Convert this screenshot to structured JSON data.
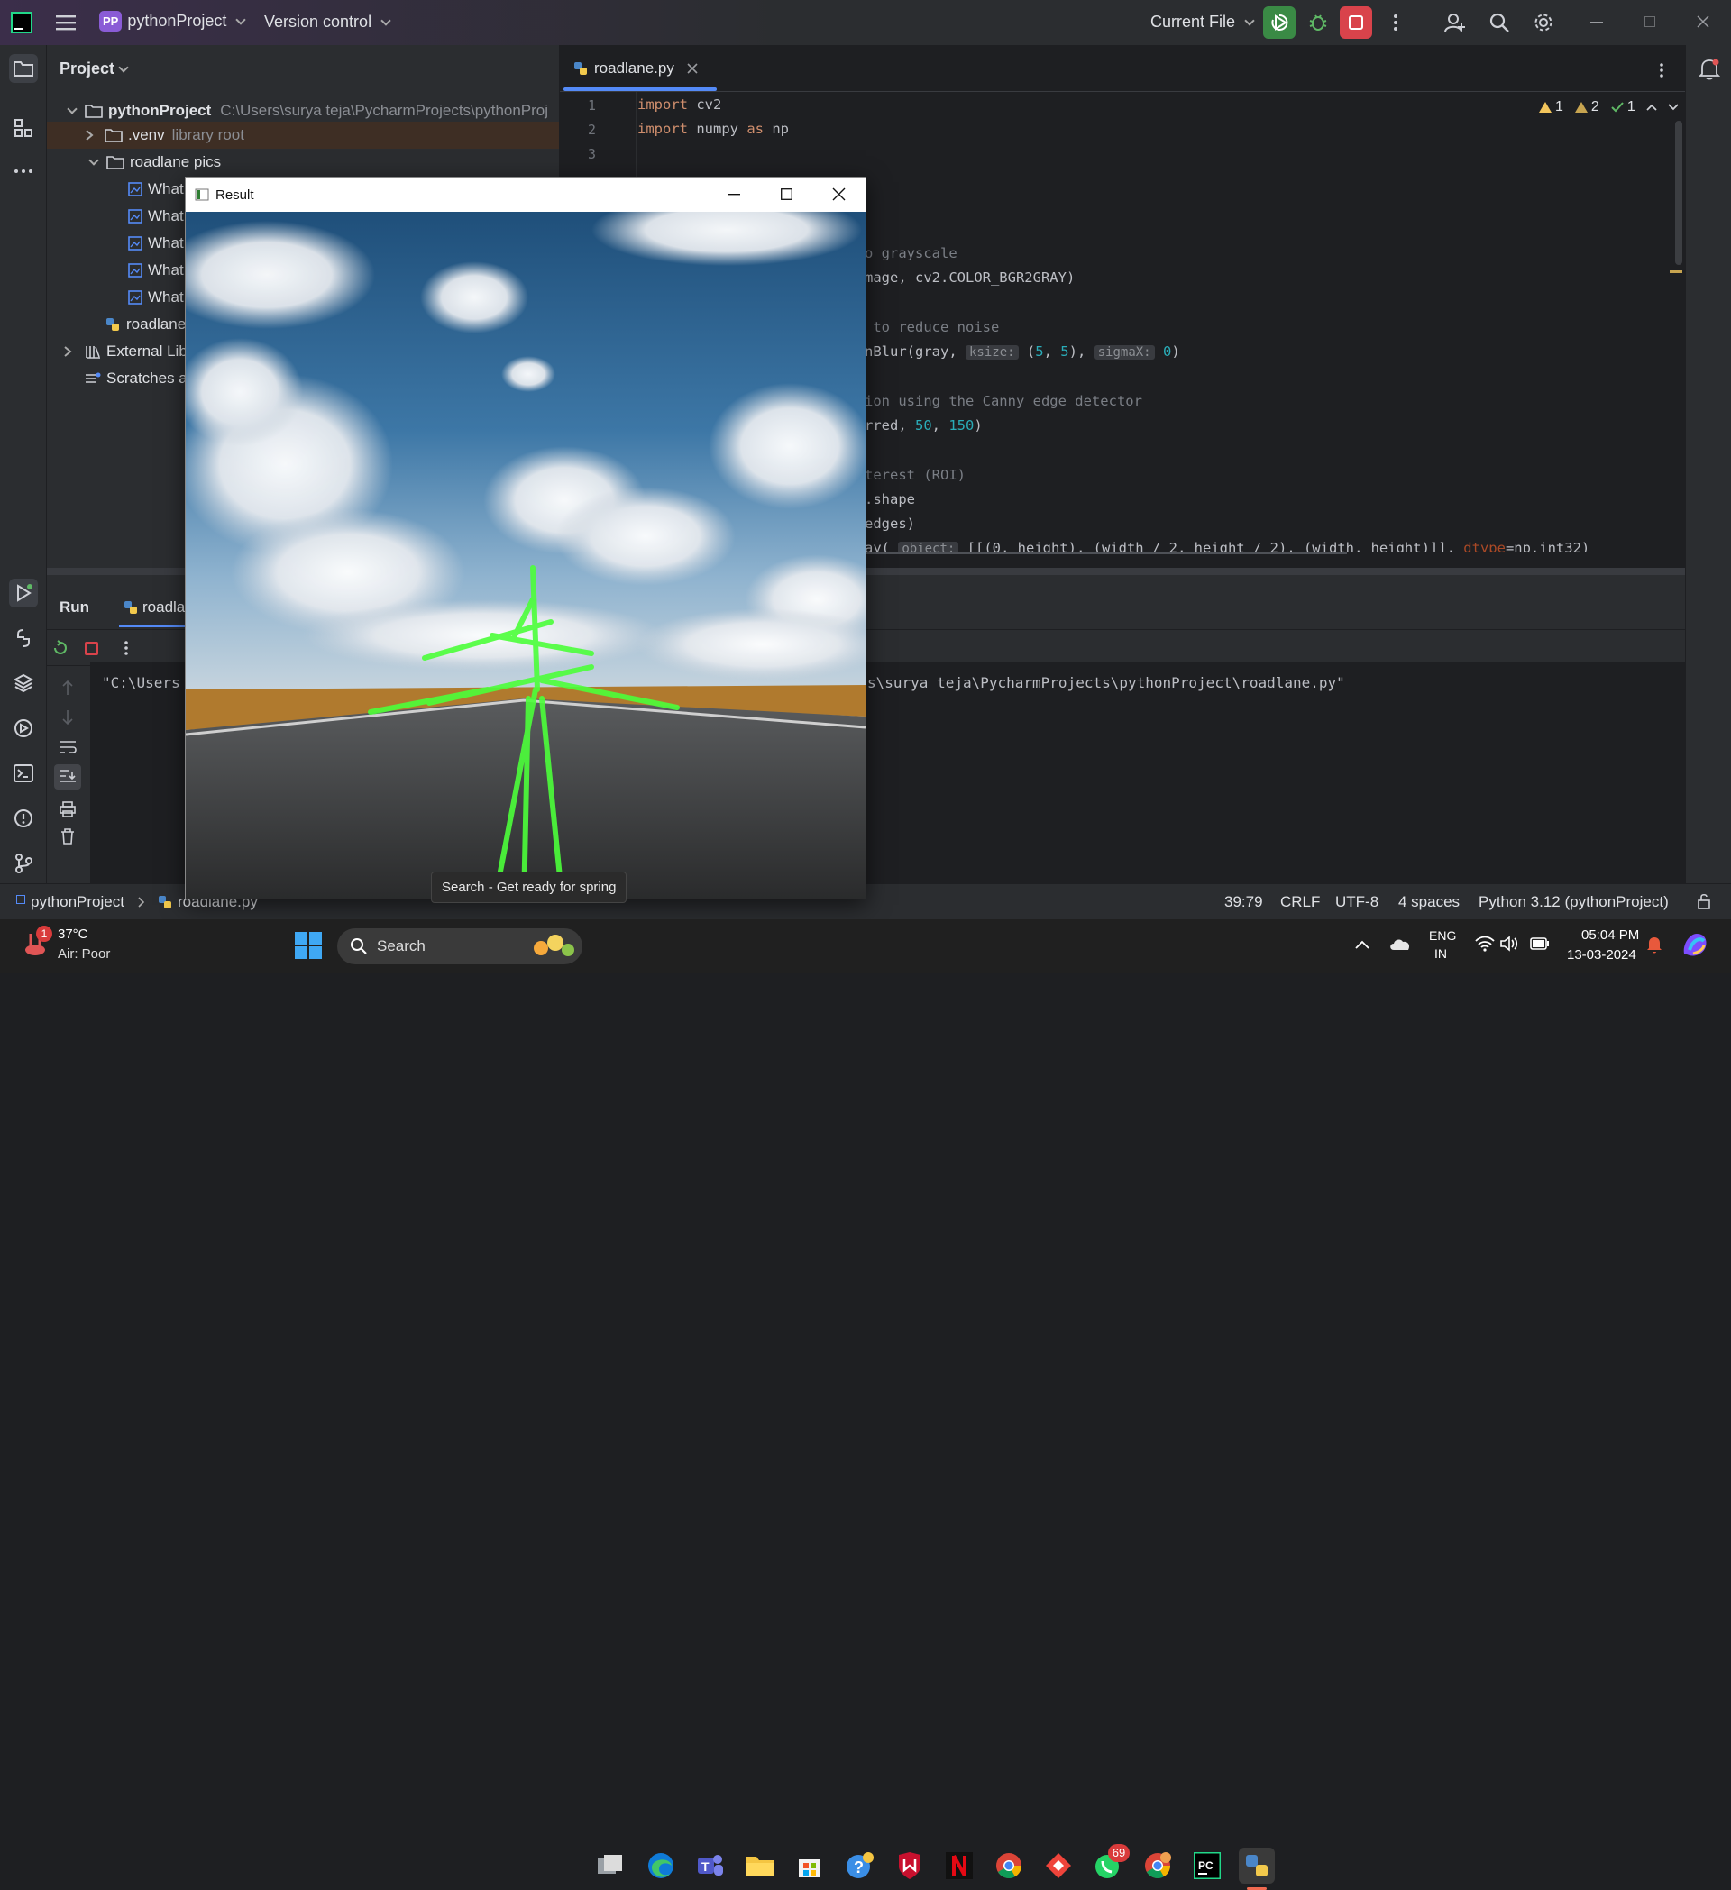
{
  "titlebar": {
    "project_badge": "PP",
    "project_name": "pythonProject",
    "version_control": "Version control",
    "run_config": "Current File"
  },
  "project_panel": {
    "title": "Project",
    "root_name": "pythonProject",
    "root_path": "C:\\Users\\surya teja\\PycharmProjects\\pythonProj",
    "venv": ".venv",
    "venv_note": "library root",
    "folder": "roadlane pics",
    "files": [
      "What",
      "What",
      "What",
      "What",
      "What"
    ],
    "script": "roadlane",
    "external": "External Lib",
    "scratches": "Scratches a"
  },
  "editor": {
    "tab_label": "roadlane.py",
    "inspections": {
      "warn1": "1",
      "warn2": "2",
      "ok": "1"
    },
    "line_numbers": [
      "1",
      "2",
      "3"
    ],
    "lines": {
      "l1_kw": "import",
      "l1_rest": " cv2",
      "l2_kw": "import",
      "l2_mod": " numpy ",
      "l2_as": "as",
      "l2_alias": " np",
      "l6": "o grayscale",
      "l7": "mage, cv2.COLOR_BGR2GRAY)",
      "l9": " to reduce noise",
      "l10_a": "nBlur(gray, ",
      "l10_hint1": "ksize:",
      "l10_b": "(",
      "l10_n1": "5",
      "l10_c": ", ",
      "l10_n2": "5",
      "l10_d": "), ",
      "l10_hint2": "sigmaX:",
      "l10_n3": "0",
      "l10_e": ")",
      "l12": "ion using the Canny edge detector",
      "l13_a": "rred, ",
      "l13_n1": "50",
      "l13_b": ", ",
      "l13_n2": "150",
      "l13_c": ")",
      "l15": "terest (ROI)",
      "l16": ".shape",
      "l17": "edges)",
      "l18_a": "ay( ",
      "l18_hint": "object:",
      "l18_b": " [[(0, height), (width / 2, height / 2), (width, height)]], ",
      "l18_c": "dtype",
      "l18_d": "=np.int32)"
    }
  },
  "run_panel": {
    "title": "Run",
    "tab": "roadla",
    "console_left": "\"C:\\Users",
    "console_right": "s\\surya teja\\PycharmProjects\\pythonProject\\roadlane.py\""
  },
  "result_window": {
    "title": "Result",
    "tooltip": "Search - Get ready for spring"
  },
  "statusbar": {
    "project": "pythonProject",
    "file": "roadlane.py",
    "position": "39:79",
    "line_ending": "CRLF",
    "encoding": "UTF-8",
    "indent": "4 spaces",
    "interpreter": "Python 3.12 (pythonProject)"
  },
  "taskbar": {
    "weather_temp": "37°C",
    "weather_note": "Air: Poor",
    "weather_badge": "1",
    "search": "Search",
    "whatsapp_badge": "69",
    "lang": "ENG",
    "region": "IN",
    "time": "05:04 PM",
    "date": "13-03-2024"
  }
}
